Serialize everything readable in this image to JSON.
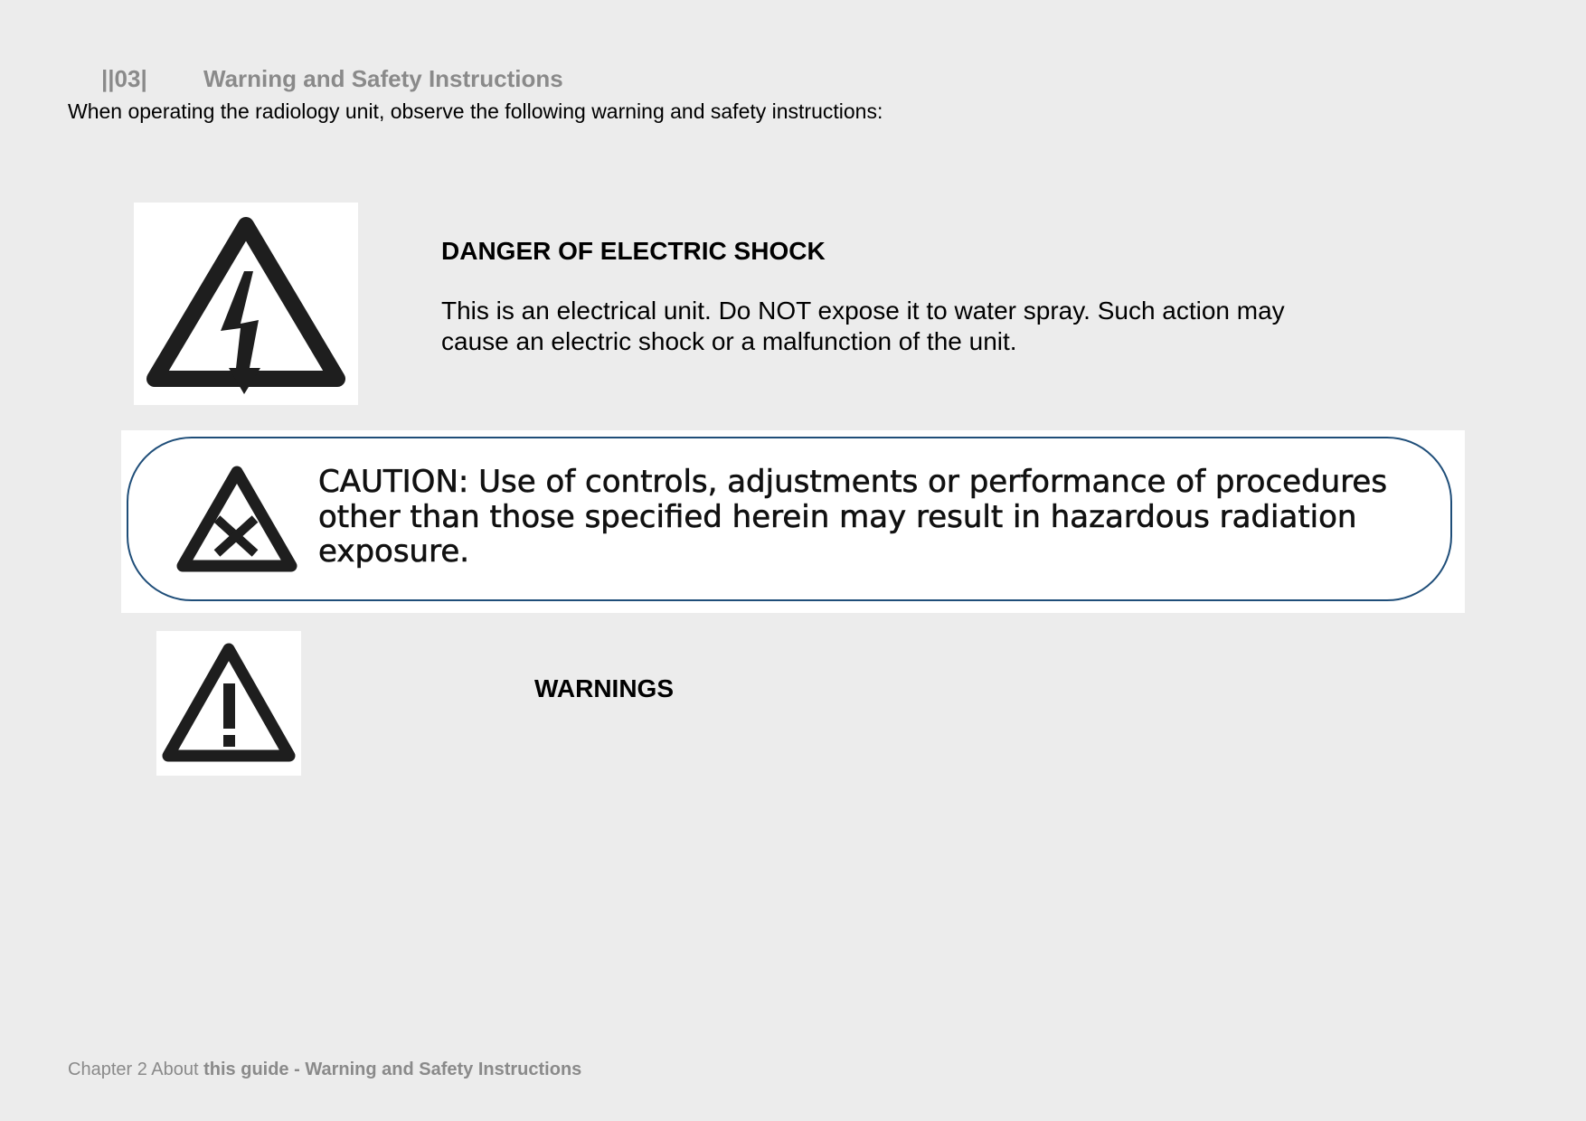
{
  "header": {
    "page_number": "||03|",
    "title": "Warning and Safety Instructions"
  },
  "intro": "When operating the radiology unit, observe the following warning and safety instructions:",
  "danger": {
    "icon": "electric-shock-triangle-icon",
    "title": "DANGER OF ELECTRIC SHOCK",
    "text": "This is an electrical unit. Do NOT expose it to water spray. Such action may cause an electric shock or a malfunction of the unit."
  },
  "caution": {
    "icon": "caution-x-triangle-icon",
    "text": "CAUTION:  Use of controls, adjustments or performance of procedures other than those specified herein may result in hazardous radiation exposure.",
    "frame_color": "#1f4e79"
  },
  "warnings": {
    "icon": "exclamation-triangle-icon",
    "title": "WARNINGS"
  },
  "footer": {
    "prefix": "Chapter 2 About ",
    "bold": "this guide - Warning and Safety Instructions"
  }
}
